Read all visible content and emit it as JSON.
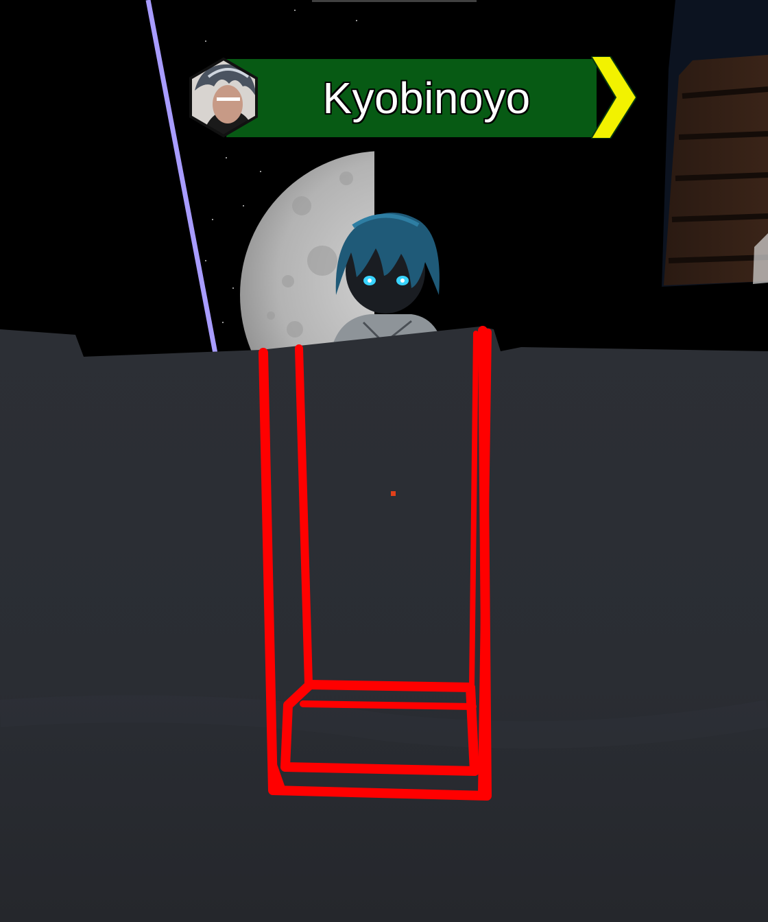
{
  "nameplate": {
    "player_name": "Kyobinoyo",
    "avatar_icon": "player-avatar-hexagon-icon",
    "chevron_icon": "chevron-right-icon"
  },
  "colors": {
    "nameplate_bar": "#075a14",
    "chevron": "#f2f200",
    "selection_outline": "#ff0000",
    "laser_beam": "#a89cff",
    "surface": "#2a2d33",
    "sky": "#000000",
    "moon": "#bdbdbd",
    "crosshair": "#e0401a"
  }
}
